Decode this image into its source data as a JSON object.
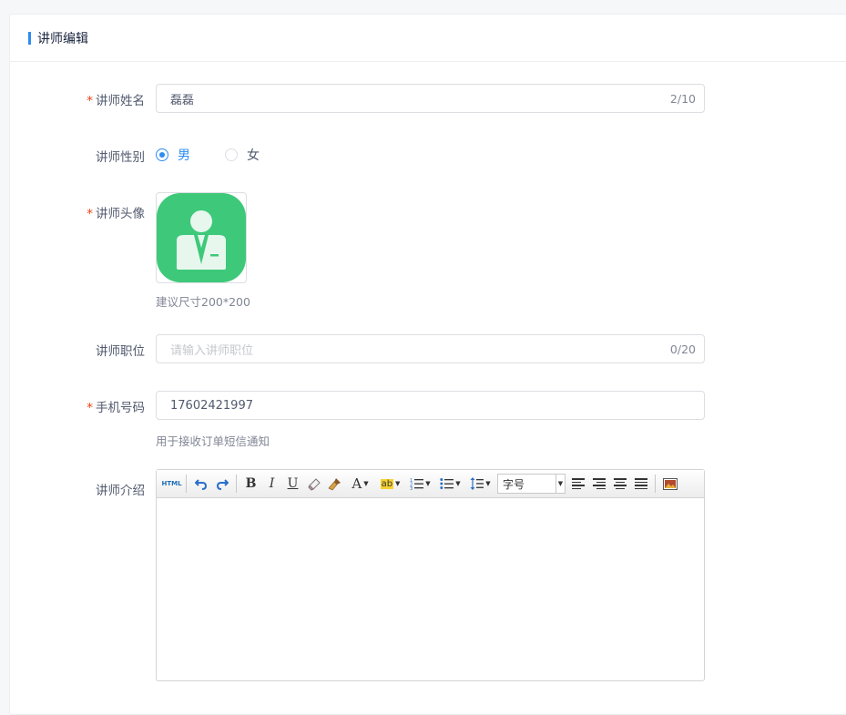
{
  "header": {
    "title": "讲师编辑"
  },
  "form": {
    "name": {
      "label": "讲师姓名",
      "required": true,
      "value": "磊磊",
      "count": "2/10"
    },
    "gender": {
      "label": "讲师性别",
      "options": [
        "男",
        "女"
      ],
      "selected": "男"
    },
    "avatar": {
      "label": "讲师头像",
      "required": true,
      "hint": "建议尺寸200*200"
    },
    "position": {
      "label": "讲师职位",
      "placeholder": "请输入讲师职位",
      "count": "0/20"
    },
    "phone": {
      "label": "手机号码",
      "required": true,
      "value": "17602421997",
      "hint": "用于接收订单短信通知"
    },
    "intro": {
      "label": "讲师介绍"
    }
  },
  "editor": {
    "html_label": "HTML",
    "bold": "B",
    "italic": "I",
    "underline": "U",
    "font_color": "A",
    "highlight": "ab",
    "fontsize_label": "字号",
    "icons": [
      "html-icon",
      "undo-icon",
      "redo-icon",
      "bold-icon",
      "italic-icon",
      "underline-icon",
      "eraser-icon",
      "format-brush-icon",
      "font-color-icon",
      "highlight-icon",
      "ordered-list-icon",
      "unordered-list-icon",
      "line-height-icon",
      "align-left-icon",
      "align-right-icon",
      "align-center-icon",
      "align-justify-icon",
      "image-icon"
    ]
  },
  "colors": {
    "accent": "#2d8cf0",
    "required": "#ed4014",
    "avatar_green": "#3ec97a"
  }
}
